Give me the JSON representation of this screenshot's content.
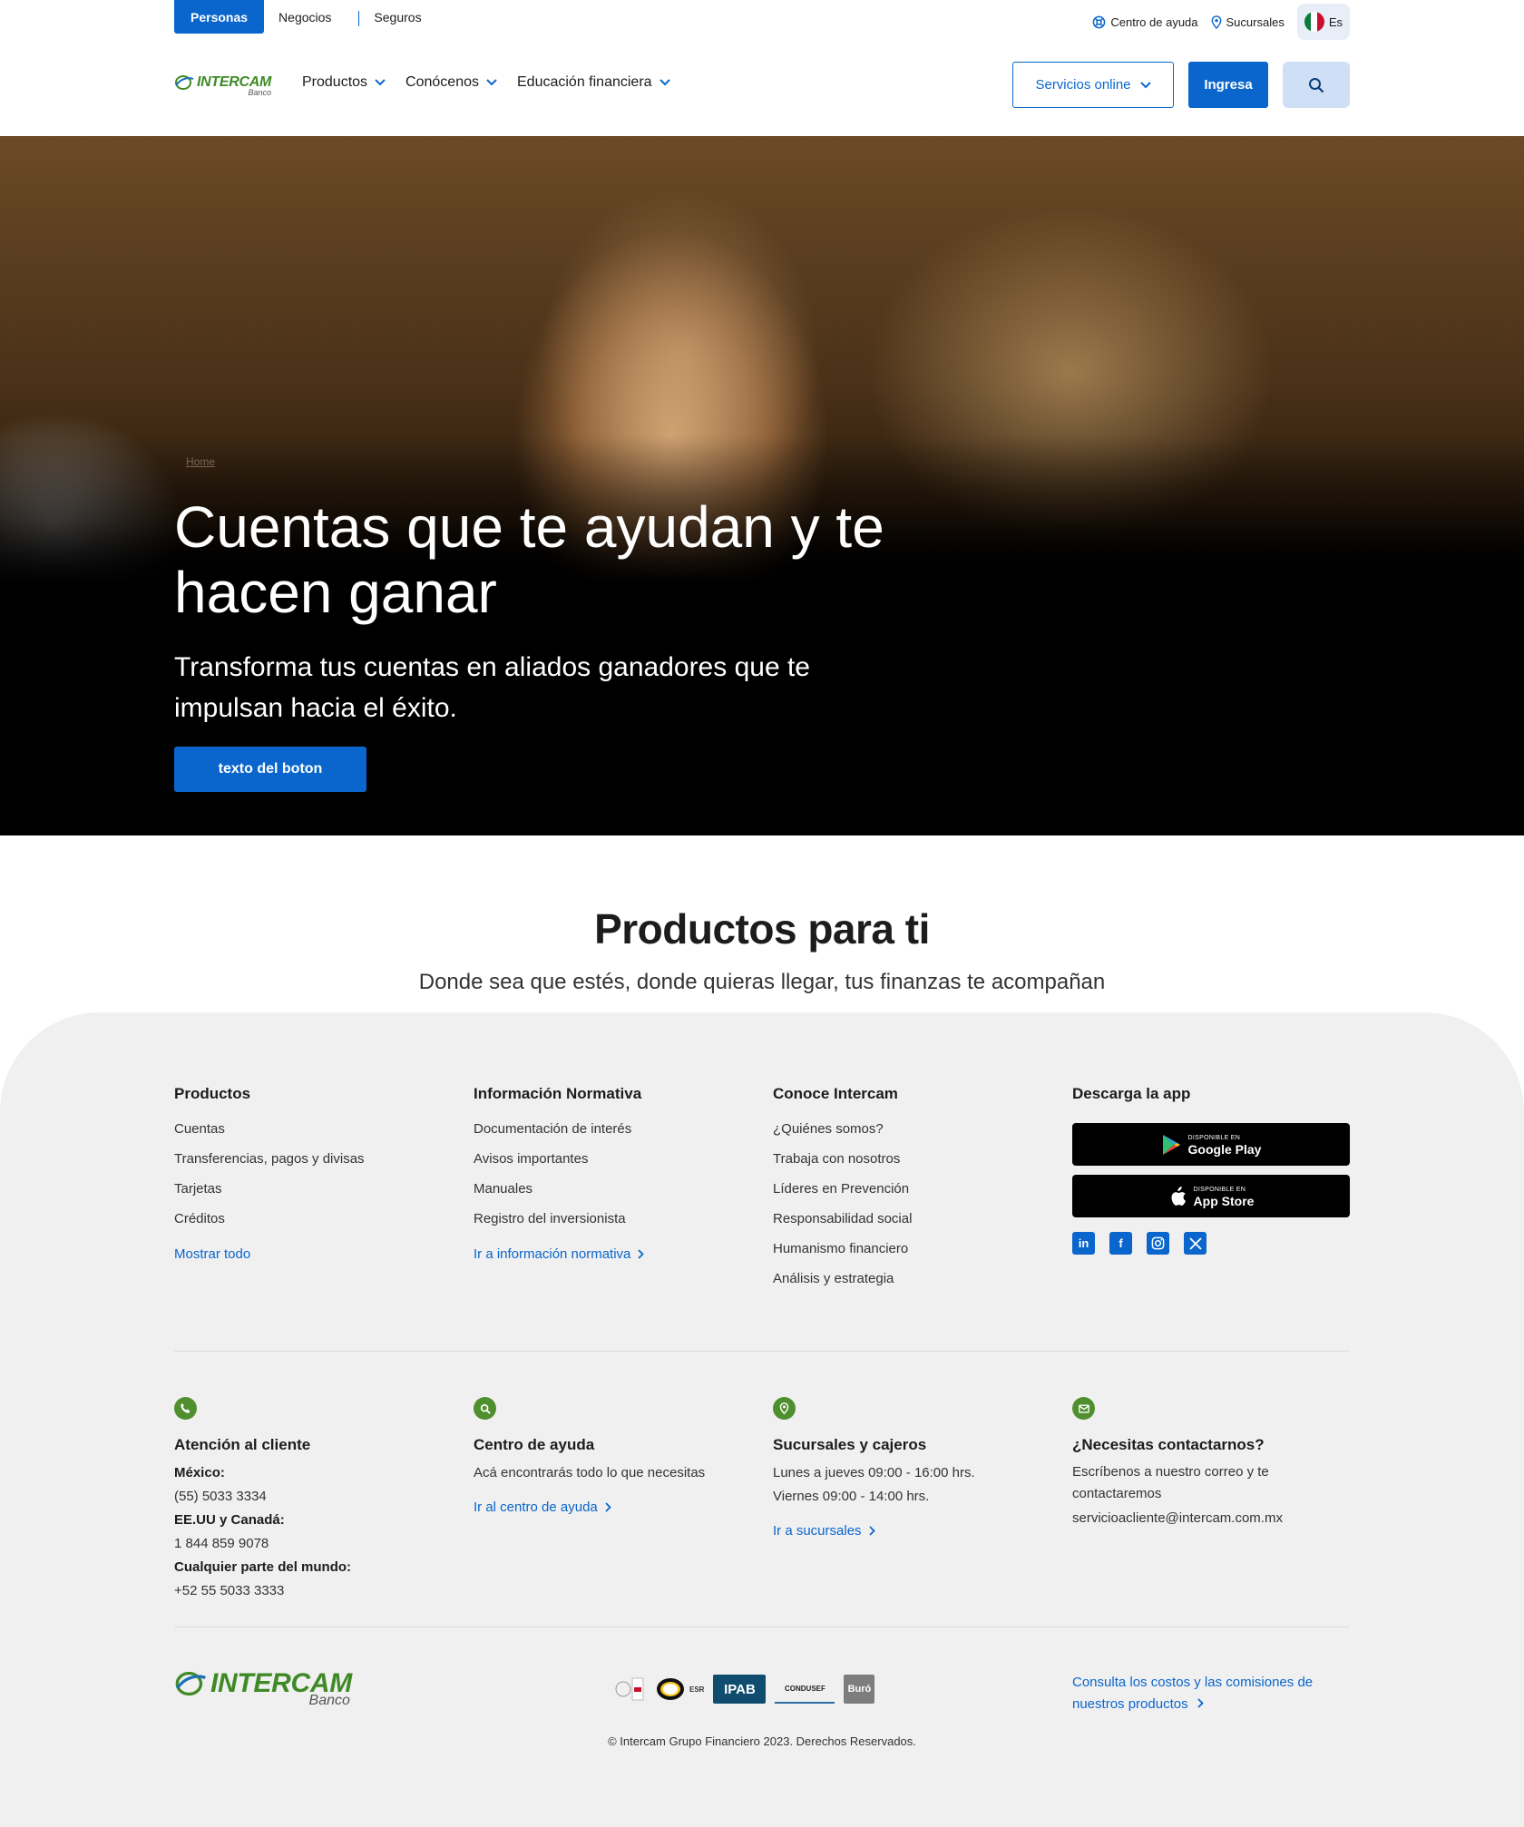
{
  "header": {
    "segments": [
      "Personas",
      "Negocios",
      "Seguros"
    ],
    "help_label": "Centro de ayuda",
    "branches_label": "Sucursales",
    "lang_label": "Es",
    "logo_text": "INTERCAM",
    "logo_sub": "Banco",
    "nav": [
      "Productos",
      "Conócenos",
      "Educación financiera"
    ],
    "services_label": "Servicios online",
    "login_label": "Ingresa"
  },
  "hero": {
    "breadcrumb": "Home",
    "title": "Cuentas que te ayudan y te hacen ganar",
    "subtitle": "Transforma tus cuentas en aliados ganadores que te impulsan hacia el éxito.",
    "button": "texto del boton"
  },
  "products": {
    "title": "Productos para ti",
    "subtitle": "Donde sea que estés, donde quieras llegar, tus finanzas te acompañan"
  },
  "footer": {
    "columns": [
      {
        "title": "Productos",
        "links": [
          "Cuentas",
          "Transferencias, pagos y divisas",
          "Tarjetas",
          "Créditos"
        ],
        "more": "Mostrar todo"
      },
      {
        "title": "Información Normativa",
        "links": [
          "Documentación de interés",
          "Avisos importantes",
          "Manuales",
          "Registro del inversionista"
        ],
        "more": "Ir a información normativa"
      },
      {
        "title": "Conoce Intercam",
        "links": [
          "¿Quiénes somos?",
          "Trabaja con nosotros",
          "Líderes en Prevención",
          "Responsabilidad social",
          "Humanismo financiero",
          "Análisis y estrategia"
        ]
      }
    ],
    "app": {
      "title": "Descarga la app",
      "google_small": "DISPONIBLE EN",
      "google_big": "Google Play",
      "apple_small": "DISPONIBLE EN",
      "apple_big": "App Store"
    },
    "contact": {
      "customer": {
        "title": "Atención al cliente",
        "mx_label": "México:",
        "mx_phone": "(55) 5033 3334",
        "us_label": "EE.UU y Canadá:",
        "us_phone": "1 844 859 9078",
        "world_label": "Cualquier parte del mundo:",
        "world_phone": "+52 55 5033 3333"
      },
      "help": {
        "title": "Centro de ayuda",
        "text": "Acá encontrarás todo lo que necesitas",
        "link": "Ir al centro de ayuda"
      },
      "branches": {
        "title": "Sucursales y cajeros",
        "line1": "Lunes a jueves 09:00 - 16:00 hrs.",
        "line2": "Viernes 09:00 - 14:00 hrs.",
        "link": "Ir a sucursales"
      },
      "email": {
        "title": "¿Necesitas contactarnos?",
        "text": "Escríbenos a nuestro correo y te contactaremos",
        "address": "servicioacliente@intercam.com.mx"
      }
    },
    "badges": [
      "ESR",
      "IPAB",
      "CONDUSEF",
      "Buró"
    ],
    "copyright": "© Intercam Grupo Financiero 2023. Derechos Reservados.",
    "costs_link": "Consulta los costos y las comisiones de nuestros productos"
  },
  "colors": {
    "primary": "#0a66cc",
    "brand_green": "#3f8a26",
    "footer_bg": "#f0f0f0"
  }
}
